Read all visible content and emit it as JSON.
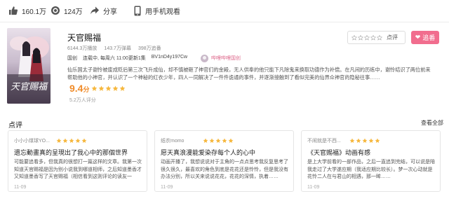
{
  "topbar": {
    "likes": "160.1万",
    "coins": "124万",
    "share": "分享",
    "mobile": "用手机观看"
  },
  "anime": {
    "title": "天官赐福",
    "stats": [
      "6144.3万播放",
      "143.7万弹幕",
      "398万追番"
    ],
    "meta": [
      "国创",
      "连载中, 每周六 11:00更新1集",
      "BV1nD4y197Cw"
    ],
    "uploader": "哔哩哔哩国创",
    "description": "仙乐国太子谢怜被废成贬后第三次飞升成仙，却不慎被砸了神官们的金殿，无人供奉的他只能下凡除鬼来换取功德作为补偿。在凡间的历练中，谢怜结识了两位前来帮助他的小神官，并认识了一个神秘的红衣少年，四人一同解决了一件件诡谲的事件，并逐渐接触到了看似完美的仙界众神官的隐秘往事……",
    "score": "9.4",
    "score_unit": "分",
    "score_count": "5.2万人评分",
    "rating_value": 5,
    "cover_text": "天官赐福"
  },
  "actions": {
    "rate_label": "点评",
    "chase_label": "追番",
    "chase_icon": "heart-plus-icon"
  },
  "reviews": {
    "section_title": "点评",
    "more_label": "查看全部",
    "items": [
      {
        "user": "小小小煤球YO...",
        "stars": 5,
        "title": "遗忘動畫真的呈現出了我心中的那個世界",
        "body": "可能要追看多，但我真的很想打一篇这样的文章。我第一次知道天官赐福是因为别小说我到哪道相师，之后知道墨香才又知道墨香写了天官赐福（相信看到这则评论的读友一定……",
        "date": "11-09"
      },
      {
        "user": "纸农momo",
        "stars": 5,
        "title": "愿天真浪漫能爱染存每个人的心中",
        "body": "动画开播了，我想说说对于主角的一点点思考我反复思考了很久很久，最喜欢的角色到底是花花还是怜怜，但是我没有办法分别，所以关来说说花花，花花的深情，执着……",
        "date": "11-09"
      },
      {
        "user": "不闹就是不西...",
        "stars": 5,
        "title": "《天官赐福》动画有感",
        "body": "是上大学前看的一部作品，之后一直追到完结，可以说是陪我走过了大学遂应期（我适应期比较长）。梦一次心动就是花怜二人在与君山的相遇，那一眸……",
        "date": "11-09"
      }
    ]
  },
  "colors": {
    "accent_pink": "#f16d8e",
    "score_orange": "#f08c2a",
    "star_gold": "#f6b73c",
    "uploader_pink": "#de698c"
  }
}
